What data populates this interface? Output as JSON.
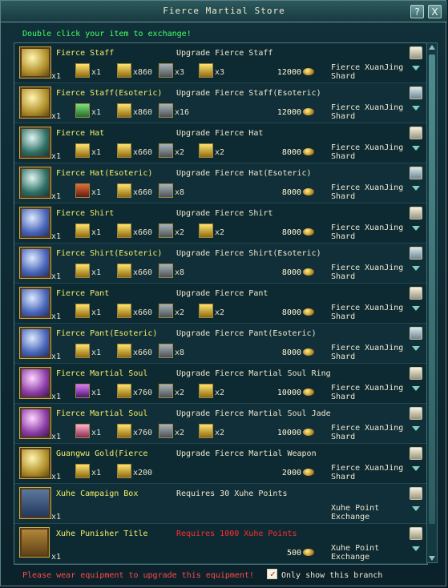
{
  "window": {
    "title": "Fierce Martial Store",
    "help": "?",
    "close": "X"
  },
  "hint": "Double click your item to exchange!",
  "rows": [
    {
      "name": "Fierce Staff",
      "desc": "Upgrade Fierce Staff",
      "qty": "x1",
      "m1": "x1",
      "m2": "x860",
      "m3": "x3",
      "m4": "x3",
      "price": "12000",
      "shard": "Fierce XuanJing Shard"
    },
    {
      "name": "Fierce Staff(Esoteric)",
      "desc": "Upgrade Fierce Staff(Esoteric)",
      "qty": "x1",
      "m1": "x1",
      "m2": "x860",
      "m3": "x16",
      "m4": "",
      "price": "12000",
      "shard": "Fierce XuanJing Shard"
    },
    {
      "name": "Fierce Hat",
      "desc": "Upgrade Fierce Hat",
      "qty": "x1",
      "m1": "x1",
      "m2": "x660",
      "m3": "x2",
      "m4": "x2",
      "price": "8000",
      "shard": "Fierce XuanJing Shard"
    },
    {
      "name": "Fierce Hat(Esoteric)",
      "desc": "Upgrade Fierce Hat(Esoteric)",
      "qty": "x1",
      "m1": "x1",
      "m2": "x660",
      "m3": "x8",
      "m4": "",
      "price": "8000",
      "shard": "Fierce XuanJing Shard"
    },
    {
      "name": "Fierce Shirt",
      "desc": "Upgrade Fierce Shirt",
      "qty": "x1",
      "m1": "x1",
      "m2": "x660",
      "m3": "x2",
      "m4": "x2",
      "price": "8000",
      "shard": "Fierce XuanJing Shard"
    },
    {
      "name": "Fierce Shirt(Esoteric)",
      "desc": "Upgrade Fierce Shirt(Esoteric)",
      "qty": "x1",
      "m1": "x1",
      "m2": "x660",
      "m3": "x8",
      "m4": "",
      "price": "8000",
      "shard": "Fierce XuanJing Shard"
    },
    {
      "name": "Fierce Pant",
      "desc": "Upgrade Fierce Pant",
      "qty": "x1",
      "m1": "x1",
      "m2": "x660",
      "m3": "x2",
      "m4": "x2",
      "price": "8000",
      "shard": "Fierce XuanJing Shard"
    },
    {
      "name": "Fierce Pant(Esoteric)",
      "desc": "Upgrade Fierce Pant(Esoteric)",
      "qty": "x1",
      "m1": "x1",
      "m2": "x660",
      "m3": "x8",
      "m4": "",
      "price": "8000",
      "shard": "Fierce XuanJing Shard"
    },
    {
      "name": "Fierce Martial Soul",
      "desc": "Upgrade Fierce Martial Soul Ring",
      "qty": "x1",
      "m1": "x1",
      "m2": "x760",
      "m3": "x2",
      "m4": "x2",
      "price": "10000",
      "shard": "Fierce XuanJing Shard"
    },
    {
      "name": "Fierce Martial Soul",
      "desc": "Upgrade Fierce Martial Soul Jade",
      "qty": "x1",
      "m1": "x1",
      "m2": "x760",
      "m3": "x2",
      "m4": "x2",
      "price": "10000",
      "shard": "Fierce XuanJing Shard"
    },
    {
      "name": "Guangwu Gold(Fierce",
      "desc": "Upgrade Fierce Martial Weapon",
      "qty": "x1",
      "m1": "x1",
      "m2": "x200",
      "m3": "",
      "m4": "",
      "price": "2000",
      "shard": "Fierce XuanJing Shard"
    },
    {
      "name": "Xuhe Campaign Box",
      "desc": "Requires 30 Xuhe Points",
      "qty": "x1",
      "m1": "",
      "m2": "",
      "m3": "",
      "m4": "",
      "price": "",
      "shard": "Xuhe Point Exchange"
    },
    {
      "name": "Xuhe Punisher Title",
      "desc": "Requires 1000 Xuhe Points",
      "qty": "x1",
      "m1": "",
      "m2": "",
      "m3": "",
      "m4": "",
      "price": "500",
      "shard": "Xuhe Point Exchange"
    }
  ],
  "footer": {
    "warning": "Please wear equipment to upgrade this equipment!",
    "checkbox": "Only show this branch"
  }
}
